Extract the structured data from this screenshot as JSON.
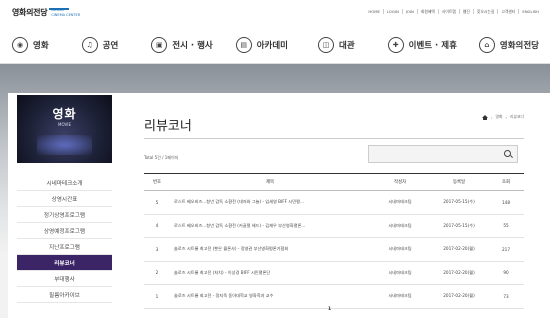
{
  "header": {
    "logo_ko": "영화의전당",
    "logo_en_1": "BUSAN",
    "logo_en_2": "CINEMA CENTER",
    "top_links": [
      "HOME",
      "LOGIN",
      "JOIN",
      "회원혜택",
      "사이트맵",
      "웹진",
      "찾오시는길",
      "고객센터",
      "ENGLISH"
    ]
  },
  "nav": {
    "items": [
      {
        "label": "영화",
        "icon": "film-reel-icon",
        "glyph": "◉"
      },
      {
        "label": "공연",
        "icon": "music-note-icon",
        "glyph": "♫"
      },
      {
        "label": "전시 · 행사",
        "icon": "gallery-icon",
        "glyph": "▣"
      },
      {
        "label": "아카데미",
        "icon": "book-icon",
        "glyph": "▤"
      },
      {
        "label": "대관",
        "icon": "folder-icon",
        "glyph": "◫"
      },
      {
        "label": "이벤트 · 제휴",
        "icon": "gift-icon",
        "glyph": "✚"
      },
      {
        "label": "영화의전당",
        "icon": "building-icon",
        "glyph": "⌂"
      }
    ]
  },
  "sidebar": {
    "title": "영화",
    "subtitle": "MOVIE",
    "items": [
      {
        "label": "시네마테크소개",
        "active": false
      },
      {
        "label": "상영시간표",
        "active": false
      },
      {
        "label": "정기상영프로그램",
        "active": false
      },
      {
        "label": "상영예정프로그램",
        "active": false
      },
      {
        "label": "지난프로그램",
        "active": false
      },
      {
        "label": "리뷰코너",
        "active": true
      },
      {
        "label": "부대행사",
        "active": false
      },
      {
        "label": "필름아카이브",
        "active": false
      }
    ]
  },
  "content": {
    "title": "리뷰코너",
    "breadcrumb": [
      "영화",
      "리뷰코너"
    ],
    "total": "Total 5건 / 1페이지",
    "search_placeholder": "",
    "table": {
      "headers": [
        "번호",
        "제목",
        "작성자",
        "등록일",
        "조회"
      ],
      "rows": [
        {
          "no": "5",
          "subject": "로스트 베오비즈...청년 감독 소환전 (대저와 그늘) - 임세영 BIFF 시민평...",
          "author": "시네마테크팀",
          "date": "2017-05-15(수)",
          "views": "148"
        },
        {
          "no": "4",
          "subject": "로스트 베오비즈...청년 감독 소환전 (커골럴 헤드) - 김재우 부산영화평론...",
          "author": "시네마테크팀",
          "date": "2017-05-15(수)",
          "views": "55"
        },
        {
          "no": "3",
          "subject": "솔로즈 시트롱 최고전 (뿐은 월론사) - 정영권 부산영화평론가협회",
          "author": "시네마테크팀",
          "date": "2017-02-20(월)",
          "views": "217"
        },
        {
          "no": "2",
          "subject": "솔로즈 시트롱 최고전 (처치) - 이상경 BIFF 시민평론단",
          "author": "시네마테크팀",
          "date": "2017-02-20(월)",
          "views": "90"
        },
        {
          "no": "1",
          "subject": "솔로즈 시트롱 회고전 - 정지욱 동아대학교 영화학과 교수",
          "author": "시네마테크팀",
          "date": "2017-02-20(월)",
          "views": "73"
        }
      ]
    },
    "pagination": "1"
  }
}
